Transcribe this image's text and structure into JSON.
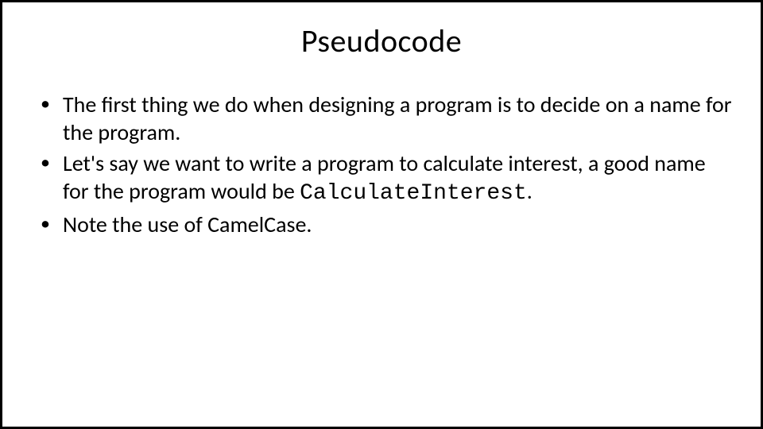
{
  "slide": {
    "title": "Pseudocode",
    "bullets": [
      {
        "text": "The first thing we do when designing a program is to decide on a name for the program."
      },
      {
        "prefix": "Let's say we want to write a program to calculate interest, a good name for the program would be ",
        "code": "CalculateInterest",
        "suffix": "."
      },
      {
        "text": "Note the use of CamelCase."
      }
    ]
  }
}
